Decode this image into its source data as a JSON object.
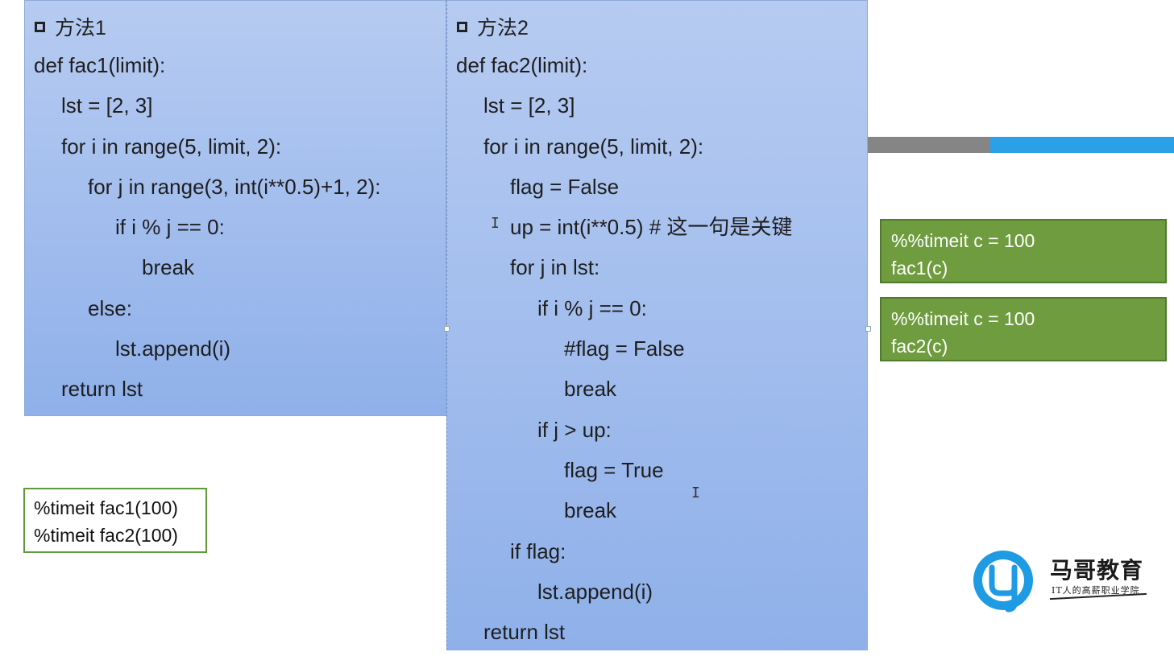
{
  "method1": {
    "heading": "方法1",
    "lines": [
      {
        "text": "def fac1(limit):",
        "indent": 0
      },
      {
        "text": "lst = [2, 3]",
        "indent": 1
      },
      {
        "text": "for i in range(5, limit, 2):",
        "indent": 1
      },
      {
        "text": "for j in range(3, int(i**0.5)+1, 2):",
        "indent": 2
      },
      {
        "text": "if i % j == 0:",
        "indent": 3
      },
      {
        "text": "break",
        "indent": 4
      },
      {
        "text": "else:",
        "indent": 2
      },
      {
        "text": "lst.append(i)",
        "indent": 3
      },
      {
        "text": "return lst",
        "indent": 1
      }
    ]
  },
  "method2": {
    "heading": "方法2",
    "lines": [
      {
        "text": "def fac2(limit):",
        "indent": 0
      },
      {
        "text": "lst = [2, 3]",
        "indent": 1
      },
      {
        "text": "for i in range(5, limit, 2):",
        "indent": 1
      },
      {
        "text": "flag = False",
        "indent": 2
      },
      {
        "text": "up = int(i**0.5) # 这一句是关键",
        "indent": 2
      },
      {
        "text": "for j in lst:",
        "indent": 2
      },
      {
        "text": "if i % j == 0:",
        "indent": 3
      },
      {
        "text": "#flag = False",
        "indent": 4
      },
      {
        "text": "break",
        "indent": 4
      },
      {
        "text": "if j > up:",
        "indent": 3
      },
      {
        "text": "flag = True",
        "indent": 4
      },
      {
        "text": "break",
        "indent": 4
      },
      {
        "text": "if flag:",
        "indent": 2
      },
      {
        "text": "lst.append(i)",
        "indent": 3
      },
      {
        "text": "return lst",
        "indent": 1
      }
    ]
  },
  "green_box_1": {
    "line1": "%%timeit c = 100",
    "line2": "fac1(c)"
  },
  "green_box_2": {
    "line1": "%%timeit c = 100",
    "line2": "fac2(c)"
  },
  "timeit_box": {
    "line1": "%timeit fac1(100)",
    "line2": "%timeit fac2(100)"
  },
  "logo": {
    "title": "马哥教育",
    "subtitle": "IT人的高薪职业学院",
    "icon": "mage-logo-icon"
  },
  "colors": {
    "panel_top": "#b6cbf1",
    "panel_bottom": "#8fb0ea",
    "green_box": "#6e9c3f",
    "bar_gray": "#858585",
    "bar_blue": "#2aa0e6",
    "logo_blue": "#1e9be3"
  }
}
